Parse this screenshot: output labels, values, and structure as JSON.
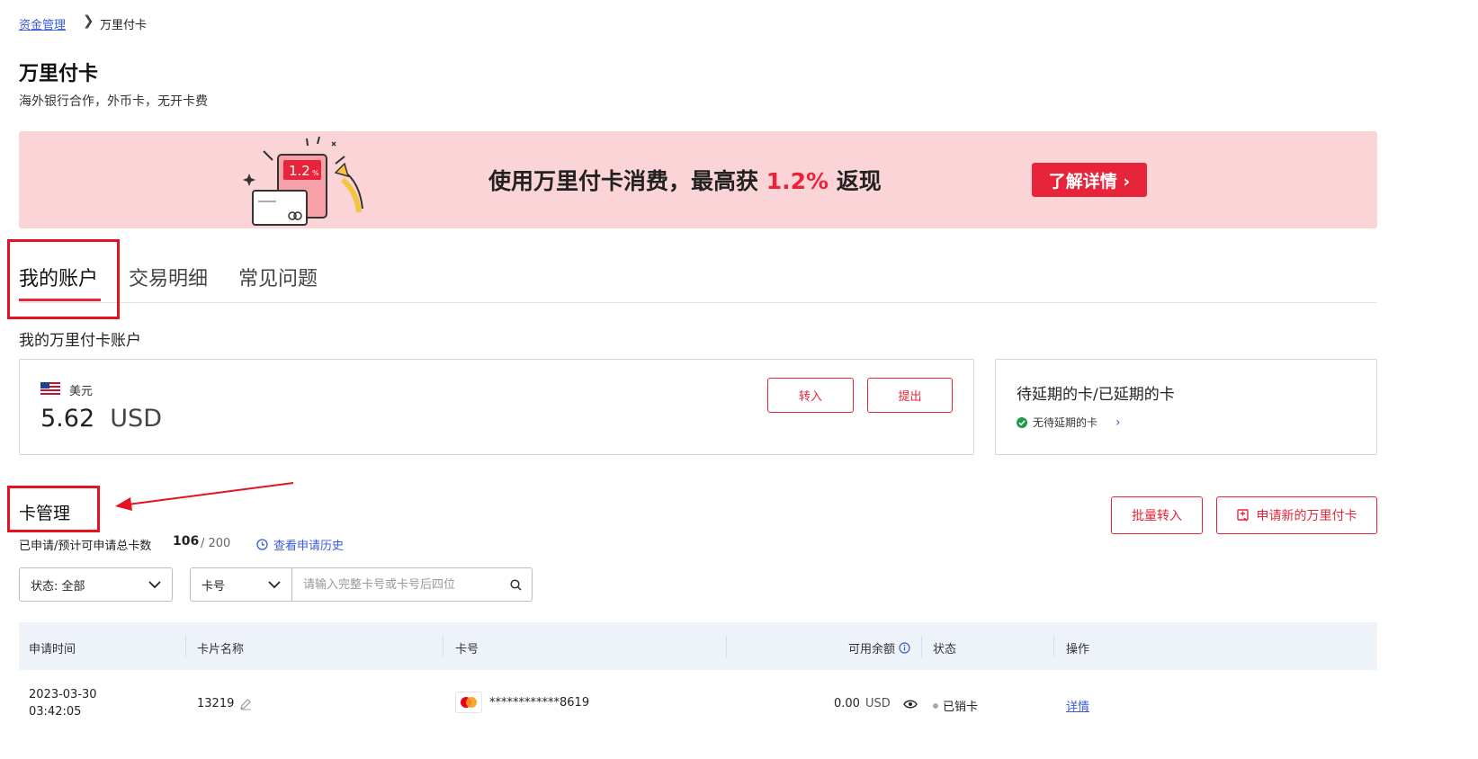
{
  "breadcrumb": {
    "parent": "资金管理",
    "separator": "❯",
    "current": "万里付卡"
  },
  "header": {
    "title": "万里付卡",
    "subtitle": "海外银行合作，外币卡，无开卡费"
  },
  "banner": {
    "illustration_value": "1.2",
    "illustration_unit": "%",
    "text_before": "使用万里付卡消费，最高获 ",
    "highlight": "1.2%",
    "text_after": " 返现",
    "button_label": "了解详情 ›",
    "background_color": "#fbd4d7",
    "accent_color": "#e8243a"
  },
  "tabs": [
    {
      "label": "我的账户",
      "active": true
    },
    {
      "label": "交易明细",
      "active": false
    },
    {
      "label": "常见问题",
      "active": false
    }
  ],
  "account": {
    "section_label": "我的万里付卡账户",
    "currency_label": "美元",
    "flag_icon": "us-flag-icon",
    "balance": "5.62",
    "balance_unit": "USD",
    "transfer_in_label": "转入",
    "withdraw_label": "提出"
  },
  "pending_cards": {
    "title": "待延期的卡/已延期的卡",
    "status": "无待延期的卡",
    "status_color": "#1e9c4a"
  },
  "card_management": {
    "title": "卡管理",
    "stats_label": "已申请/预计可申请总卡数",
    "applied_count": "106",
    "total": "/ 200",
    "history_link": "查看申请历史",
    "batch_transfer_label": "批量转入",
    "apply_new_label": "申请新的万里付卡"
  },
  "filters": {
    "status_select": "状态: 全部",
    "search_type_select": "卡号",
    "search_placeholder": "请输入完整卡号或卡号后四位"
  },
  "table": {
    "columns": [
      "申请时间",
      "卡片名称",
      "卡号",
      "可用余额",
      "状态",
      "操作"
    ],
    "rows": [
      {
        "date": "2023-03-30",
        "time": "03:42:05",
        "card_name": "13219",
        "card_number": "************8619",
        "balance": "0.00",
        "currency": "USD",
        "status": "已销卡",
        "action": "详情"
      }
    ]
  }
}
